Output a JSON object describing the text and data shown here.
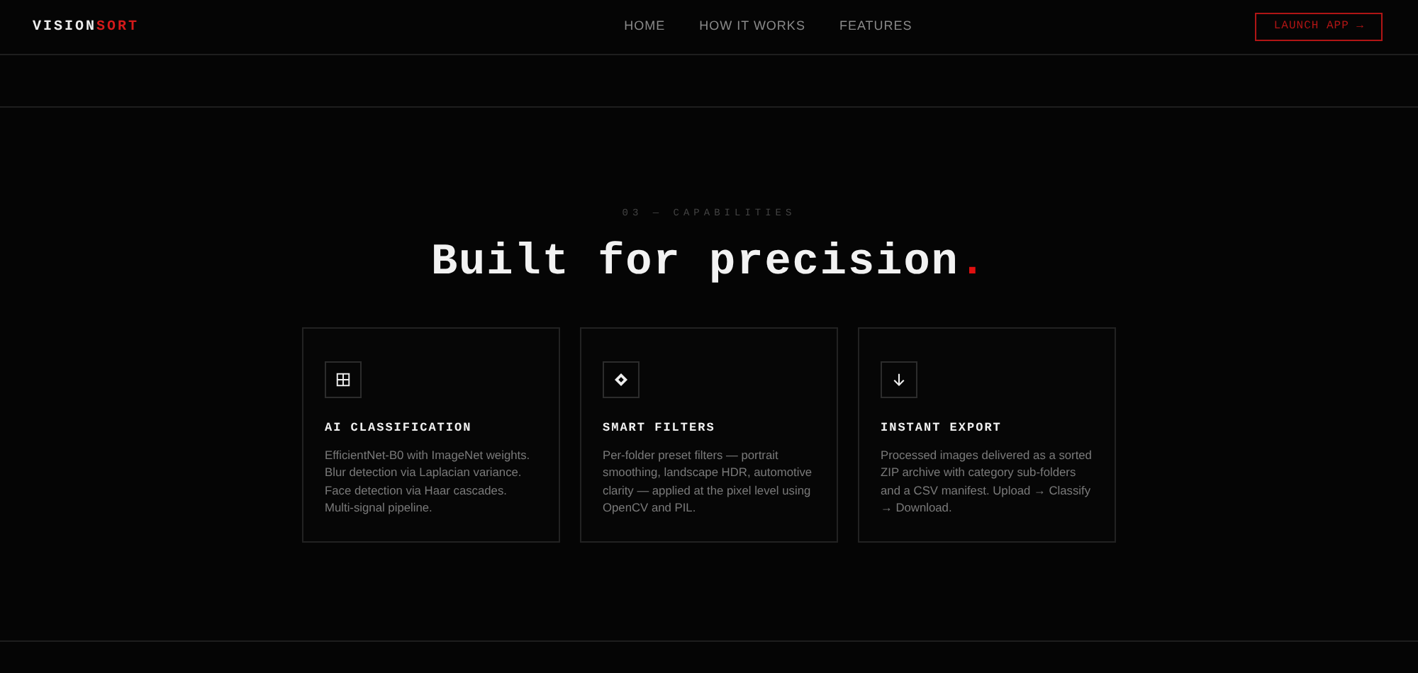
{
  "brand": {
    "main": "VISION",
    "accent": "SORT"
  },
  "nav": [
    {
      "label": "HOME"
    },
    {
      "label": "HOW IT WORKS"
    },
    {
      "label": "FEATURES"
    }
  ],
  "launch_button": "LAUNCH APP →",
  "section": {
    "eyebrow": "03 — CAPABILITIES",
    "title": "Built for precision",
    "title_accent": "."
  },
  "cards": [
    {
      "title": "AI CLASSIFICATION",
      "text": "EfficientNet-B0 with ImageNet weights. Blur detection via Laplacian variance. Face detection via Haar cascades. Multi-signal pipeline."
    },
    {
      "title": "SMART FILTERS",
      "text": "Per-folder preset filters — portrait smoothing, landscape HDR, automotive clarity — applied at the pixel level using OpenCV and PIL."
    },
    {
      "title": "INSTANT EXPORT",
      "text": "Processed images delivered as a sorted ZIP archive with category sub-folders and a CSV manifest. Upload → Classify → Download."
    }
  ]
}
